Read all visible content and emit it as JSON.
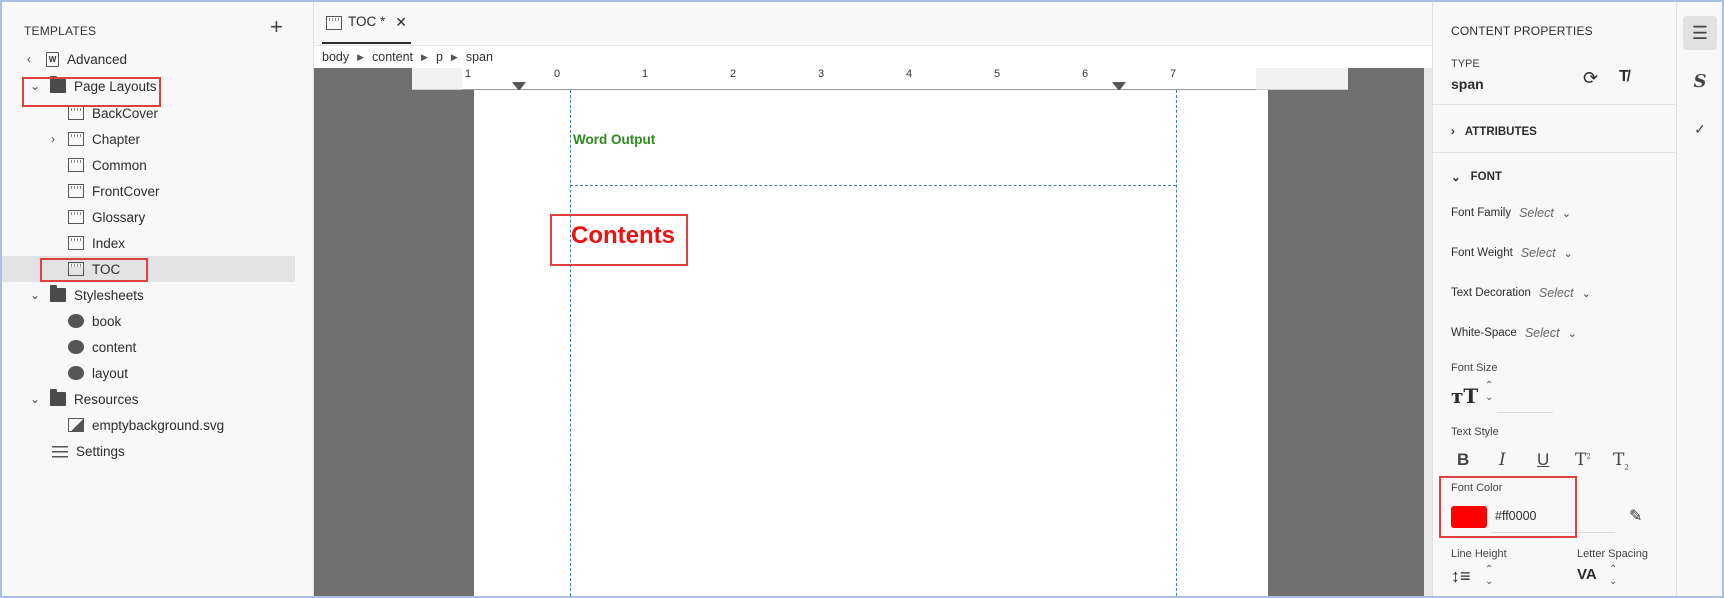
{
  "left_panel": {
    "title": "TEMPLATES",
    "add_icon": "+",
    "back_item": "Advanced",
    "tree": [
      {
        "label": "Page Layouts",
        "type": "folder",
        "expanded": true
      },
      {
        "label": "BackCover",
        "type": "layout"
      },
      {
        "label": "Chapter",
        "type": "layout",
        "collapsed": true
      },
      {
        "label": "Common",
        "type": "layout"
      },
      {
        "label": "FrontCover",
        "type": "layout"
      },
      {
        "label": "Glossary",
        "type": "layout"
      },
      {
        "label": "Index",
        "type": "layout"
      },
      {
        "label": "TOC",
        "type": "layout",
        "selected": true
      },
      {
        "label": "Stylesheets",
        "type": "folder",
        "expanded": true
      },
      {
        "label": "book",
        "type": "stylesheet"
      },
      {
        "label": "content",
        "type": "stylesheet"
      },
      {
        "label": "layout",
        "type": "stylesheet"
      },
      {
        "label": "Resources",
        "type": "folder",
        "expanded": true
      },
      {
        "label": "emptybackground.svg",
        "type": "image"
      },
      {
        "label": "Settings",
        "type": "settings"
      }
    ]
  },
  "editor": {
    "tab_label": "TOC *",
    "tab_close": "✕",
    "breadcrumb": [
      "body",
      "content",
      "p",
      "span"
    ],
    "ruler_ticks": [
      "1",
      "0",
      "1",
      "2",
      "3",
      "4",
      "5",
      "6",
      "7"
    ],
    "page": {
      "header_text": "Word Output",
      "heading_text": "Contents"
    }
  },
  "properties": {
    "title": "CONTENT PROPERTIES",
    "type_label": "TYPE",
    "type_value": "span",
    "attributes_label": "ATTRIBUTES",
    "font_label": "FONT",
    "font_family_label": "Font Family",
    "font_weight_label": "Font Weight",
    "text_decoration_label": "Text Decoration",
    "white_space_label": "White-Space",
    "select_placeholder": "Select",
    "font_size_label": "Font Size",
    "text_style_label": "Text Style",
    "style_buttons": [
      "B",
      "I",
      "U",
      "T",
      "T"
    ],
    "font_color_label": "Font Color",
    "font_color_value": "#ff0000",
    "line_height_label": "Line Height",
    "letter_spacing_label": "Letter Spacing"
  },
  "colors": {
    "accent_highlight": "#e04040",
    "word_output": "#2a8a1a",
    "contents_heading": "#ee1111",
    "margin_guides": "#3b7bbf"
  }
}
